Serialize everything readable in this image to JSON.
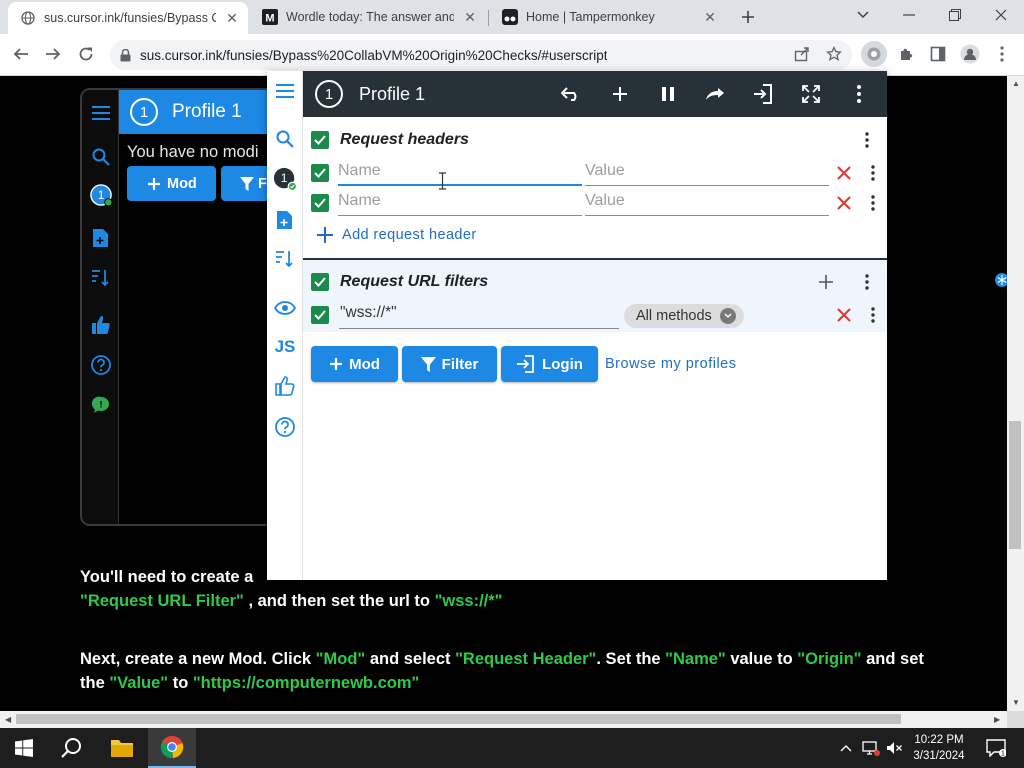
{
  "browser": {
    "tabs": [
      {
        "title": "sus.cursor.ink/funsies/Bypass Co",
        "active": true,
        "favicon": "globe-icon"
      },
      {
        "title": "Wordle today: The answer and hi",
        "active": false,
        "favicon": "m-logo-icon"
      },
      {
        "title": "Home | Tampermonkey",
        "active": false,
        "favicon": "tampermonkey-icon"
      }
    ],
    "url": "sus.cursor.ink/funsies/Bypass%20CollabVM%20Origin%20Checks/#userscript"
  },
  "page": {
    "demo": {
      "profile_number": "1",
      "profile_name": "Profile 1",
      "message": "You have no modi",
      "mod_label": "Mod",
      "filter_label": "F"
    },
    "instruction1": {
      "line1": "You'll need to create a",
      "line2_parts": [
        {
          "text": "\"Request URL Filter\"",
          "color": "green"
        },
        {
          "text": " , and then set the url to ",
          "color": "white"
        },
        {
          "text": "\"wss://*\"",
          "color": "green"
        }
      ]
    },
    "instruction2": {
      "parts": [
        {
          "text": "Next, create a new Mod. Click ",
          "color": "white"
        },
        {
          "text": "\"Mod\"",
          "color": "green"
        },
        {
          "text": " and select ",
          "color": "white"
        },
        {
          "text": "\"Request Header\"",
          "color": "green"
        },
        {
          "text": ". Set the ",
          "color": "white"
        },
        {
          "text": "\"Name\"",
          "color": "green"
        },
        {
          "text": " value to ",
          "color": "white"
        },
        {
          "text": "\"Origin\"",
          "color": "green"
        },
        {
          "text": " and set the ",
          "color": "white"
        },
        {
          "text": "\"Value\"",
          "color": "green"
        },
        {
          "text": " to ",
          "color": "white"
        },
        {
          "text": "\"https://computernewb.com\"",
          "color": "green"
        }
      ]
    }
  },
  "extension": {
    "profile_number": "1",
    "profile_name": "Profile 1",
    "request_headers": {
      "title": "Request headers",
      "rows": [
        {
          "name_placeholder": "Name",
          "value_placeholder": "Value",
          "enabled": true,
          "focused": true
        },
        {
          "name_placeholder": "Name",
          "value_placeholder": "Value",
          "enabled": true,
          "focused": false
        }
      ],
      "add_label": "Add request header"
    },
    "url_filters": {
      "title": "Request URL filters",
      "rows": [
        {
          "pattern": "\"wss://*\"",
          "methods": "All methods",
          "enabled": true
        }
      ]
    },
    "buttons": {
      "mod": "Mod",
      "filter": "Filter",
      "login": "Login",
      "browse": "Browse my profiles"
    }
  },
  "taskbar": {
    "time": "10:22 PM",
    "date": "3/31/2024"
  },
  "colors": {
    "accent_blue": "#1e88e5",
    "header_dark": "#263238",
    "check_green": "#1b8a4a",
    "delete_red": "#e53935",
    "text_green": "#30c948"
  }
}
